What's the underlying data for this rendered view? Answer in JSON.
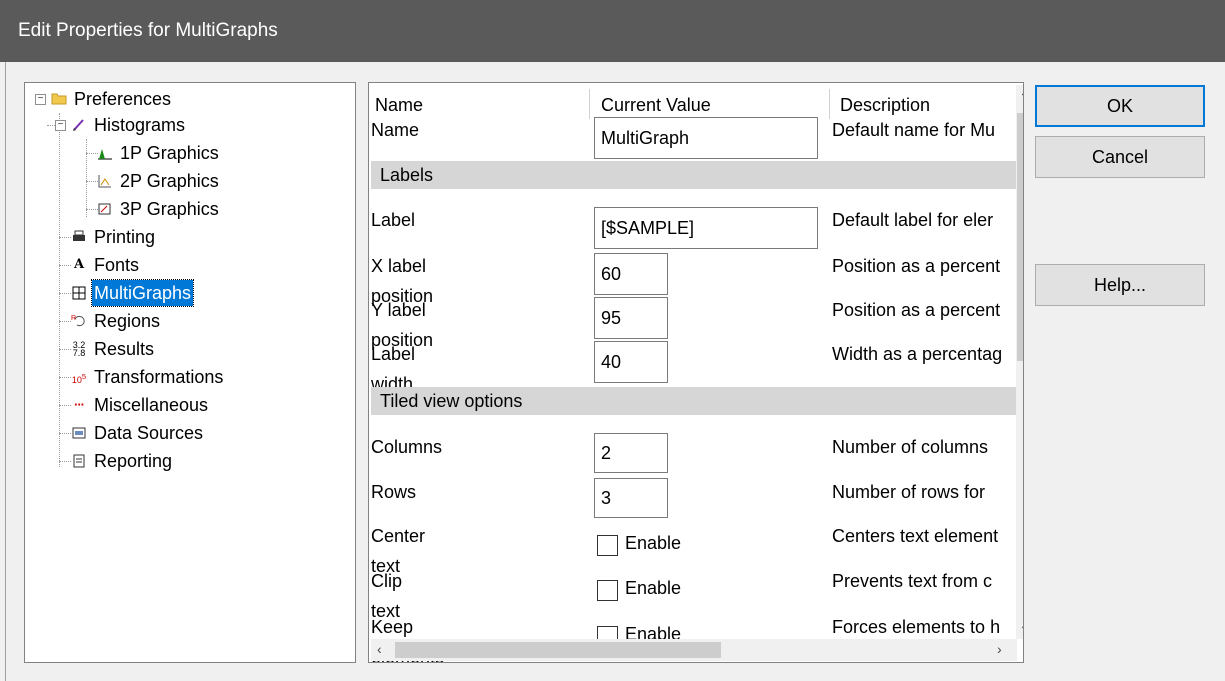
{
  "window": {
    "title": "Edit Properties for MultiGraphs"
  },
  "tree": {
    "items": [
      {
        "label": "Preferences",
        "icon": "folder-icon"
      },
      {
        "label": "Histograms",
        "icon": "histogram-icon"
      },
      {
        "label": "1P Graphics",
        "icon": "1p-graphics-icon"
      },
      {
        "label": "2P Graphics",
        "icon": "2p-graphics-icon"
      },
      {
        "label": "3P Graphics",
        "icon": "3p-graphics-icon"
      },
      {
        "label": "Printing",
        "icon": "printer-icon"
      },
      {
        "label": "Fonts",
        "icon": "font-icon"
      },
      {
        "label": "MultiGraphs",
        "icon": "multigraph-icon",
        "selected": true
      },
      {
        "label": "Regions",
        "icon": "regions-icon"
      },
      {
        "label": "Results",
        "icon": "results-icon"
      },
      {
        "label": "Transformations",
        "icon": "transformations-icon"
      },
      {
        "label": "Miscellaneous",
        "icon": "miscellaneous-icon"
      },
      {
        "label": "Data Sources",
        "icon": "data-sources-icon"
      },
      {
        "label": "Reporting",
        "icon": "reporting-icon"
      }
    ]
  },
  "grid": {
    "headers": {
      "name": "Name",
      "value": "Current Value",
      "description": "Description"
    },
    "name_row": {
      "name": "Name",
      "value": "MultiGraph",
      "description": "Default name for Mu"
    },
    "sections": {
      "labels": "Labels",
      "tiled": "Tiled view options"
    },
    "label_rows": [
      {
        "name": "Label",
        "value": "[$SAMPLE]",
        "description": "Default label for eler"
      },
      {
        "name": "X label position",
        "value": "60",
        "description": "Position as a percent"
      },
      {
        "name": "Y label position",
        "value": "95",
        "description": "Position as a percent"
      },
      {
        "name": "Label width",
        "value": "40",
        "description": "Width as a percentag"
      }
    ],
    "tiled_rows": [
      {
        "name": "Columns",
        "value": "2",
        "description": "Number of columns"
      },
      {
        "name": "Rows",
        "value": "3",
        "description": "Number of rows for"
      }
    ],
    "check_rows": [
      {
        "name": "Center text",
        "check_label": "Enable",
        "description": "Centers text element"
      },
      {
        "name": "Clip text",
        "check_label": "Enable",
        "description": "Prevents text from c"
      },
      {
        "name": "Keep elements square",
        "check_label": "Enable",
        "description": "Forces elements to h"
      }
    ]
  },
  "buttons": {
    "ok": "OK",
    "cancel": "Cancel",
    "help": "Help..."
  }
}
